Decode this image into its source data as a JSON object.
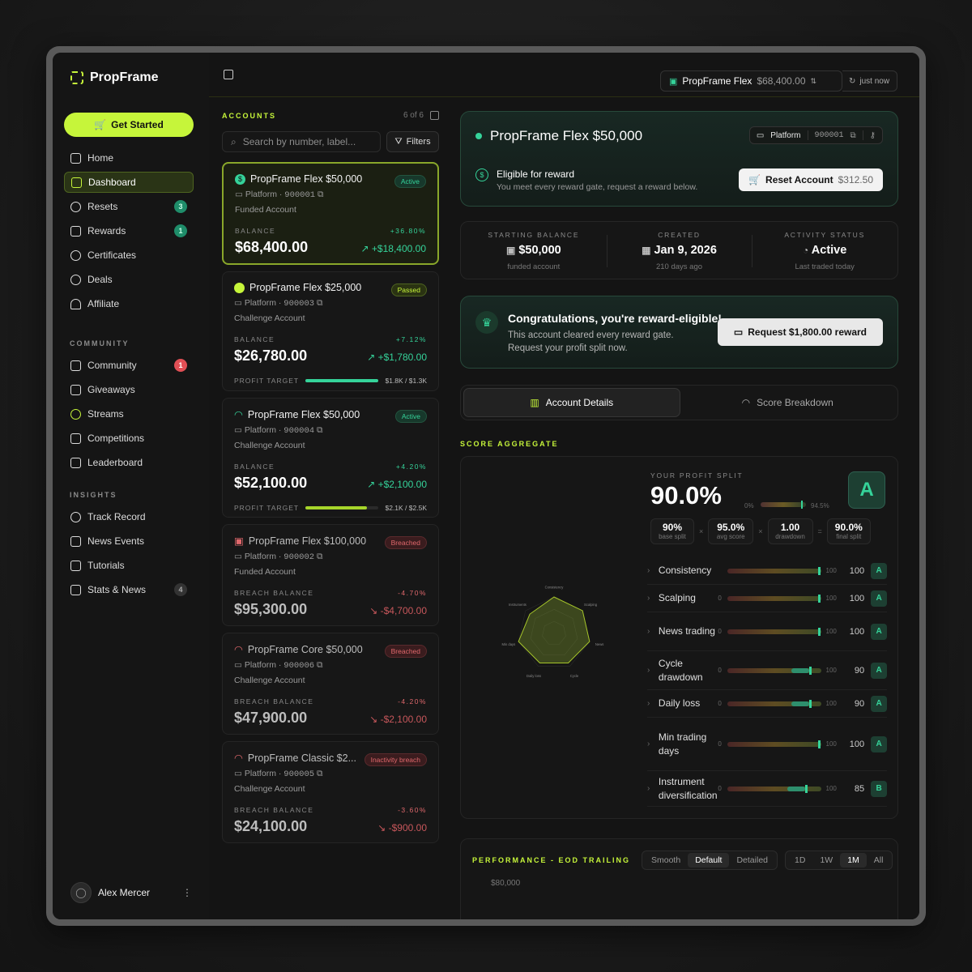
{
  "brand": {
    "name": "PropFrame",
    "accent": "#c6f53a",
    "positive": "#35d39a",
    "negative": "#e0686c"
  },
  "sidebar": {
    "cta": "Get Started",
    "main": [
      {
        "label": "Home",
        "icon": "home-icon"
      },
      {
        "label": "Dashboard",
        "icon": "grid-icon",
        "active": true
      },
      {
        "label": "Resets",
        "icon": "reset-icon",
        "badge": "3"
      },
      {
        "label": "Rewards",
        "icon": "ticket-icon",
        "badge": "1"
      },
      {
        "label": "Certificates",
        "icon": "certificate-icon"
      },
      {
        "label": "Deals",
        "icon": "tag-icon"
      },
      {
        "label": "Affiliate",
        "icon": "users-icon"
      }
    ],
    "community_title": "COMMUNITY",
    "community": [
      {
        "label": "Community",
        "badge": "1"
      },
      {
        "label": "Giveaways"
      },
      {
        "label": "Streams"
      },
      {
        "label": "Competitions"
      },
      {
        "label": "Leaderboard"
      }
    ],
    "insights_title": "INSIGHTS",
    "insights": [
      {
        "label": "Track Record"
      },
      {
        "label": "News Events"
      },
      {
        "label": "Tutorials"
      },
      {
        "label": "Stats & News",
        "badge": "4"
      }
    ],
    "user": "Alex Mercer"
  },
  "topbar": {
    "account": "PropFrame Flex",
    "balance": "$68,400.00",
    "updated": "just now"
  },
  "accounts": {
    "title": "ACCOUNTS",
    "count": "6 of 6",
    "search_placeholder": "Search by number, label...",
    "filters": "Filters",
    "items": [
      {
        "name": "PropFrame Flex $50,000",
        "status": "Active",
        "platform": "Platform",
        "number": "900001",
        "type": "Funded Account",
        "label": "BALANCE",
        "pct": "+36.80%",
        "balance": "$68,400.00",
        "delta": "+$18,400.00"
      },
      {
        "name": "PropFrame Flex $25,000",
        "status": "Passed",
        "platform": "Platform",
        "number": "900003",
        "type": "Challenge Account",
        "label": "BALANCE",
        "pct": "+7.12%",
        "balance": "$26,780.00",
        "delta": "+$1,780.00",
        "target_label": "PROFIT TARGET",
        "target": "$1.8K / $1.3K",
        "progress": 1.0
      },
      {
        "name": "PropFrame Flex $50,000",
        "status": "Active",
        "platform": "Platform",
        "number": "900004",
        "type": "Challenge Account",
        "label": "BALANCE",
        "pct": "+4.20%",
        "balance": "$52,100.00",
        "delta": "+$2,100.00",
        "target_label": "PROFIT TARGET",
        "target": "$2.1K / $2.5K",
        "progress": 0.84
      },
      {
        "name": "PropFrame Flex $100,000",
        "status": "Breached",
        "platform": "Platform",
        "number": "900002",
        "type": "Funded Account",
        "label": "BREACH BALANCE",
        "pct": "-4.70%",
        "balance": "$95,300.00",
        "delta": "-$4,700.00"
      },
      {
        "name": "PropFrame Core $50,000",
        "status": "Breached",
        "platform": "Platform",
        "number": "900006",
        "type": "Challenge Account",
        "label": "BREACH BALANCE",
        "pct": "-4.20%",
        "balance": "$47,900.00",
        "delta": "-$2,100.00"
      },
      {
        "name": "PropFrame Classic $2...",
        "status": "Inactivity breach",
        "platform": "Platform",
        "number": "900005",
        "type": "Challenge Account",
        "label": "BREACH BALANCE",
        "pct": "-3.60%",
        "balance": "$24,100.00",
        "delta": "-$900.00"
      }
    ]
  },
  "hero": {
    "title": "PropFrame Flex $50,000",
    "platform": "Platform",
    "number": "900001",
    "elig_title": "Eligible for reward",
    "elig_text": "You meet every reward gate, request a reward below.",
    "reset": "Reset Account",
    "reset_price": "$312.50"
  },
  "stats": [
    {
      "k": "STARTING BALANCE",
      "v": "$50,000",
      "s": "funded account"
    },
    {
      "k": "CREATED",
      "v": "Jan 9, 2026",
      "s": "210 days ago"
    },
    {
      "k": "ACTIVITY STATUS",
      "v": "Active",
      "s": "Last traded today"
    }
  ],
  "congrats": {
    "title": "Congratulations, you're reward-eligible!",
    "text": "This account cleared every reward gate. Request your profit split now.",
    "button": "Request $1,800.00 reward"
  },
  "tabs": [
    "Account Details",
    "Score Breakdown"
  ],
  "score": {
    "section": "SCORE AGGREGATE",
    "split_label": "YOUR PROFIT SPLIT",
    "split": "90.0%",
    "grade": "A",
    "range_min": "0%",
    "range_max": "94.5%",
    "factors": [
      {
        "v": "90%",
        "s": "base split"
      },
      {
        "v": "95.0%",
        "s": "avg score"
      },
      {
        "v": "1.00",
        "s": "drawdown"
      },
      {
        "v": "90.0%",
        "s": "final split"
      }
    ],
    "radar_labels": [
      "Consistency",
      "Scalping",
      "News",
      "Cycle",
      "Daily loss",
      "Min days",
      "Instruments"
    ],
    "rows": [
      {
        "name": "Consistency",
        "min": "",
        "max": "100",
        "score": "100",
        "grade": "A",
        "value": 100
      },
      {
        "name": "Scalping",
        "min": "0",
        "max": "100",
        "score": "100",
        "grade": "A",
        "value": 100
      },
      {
        "name": "News trading",
        "min": "0",
        "max": "100",
        "score": "100",
        "grade": "A",
        "value": 100
      },
      {
        "name": "Cycle drawdown",
        "min": "0",
        "max": "100",
        "score": "90",
        "grade": "A",
        "value": 90
      },
      {
        "name": "Daily loss",
        "min": "0",
        "max": "100",
        "score": "90",
        "grade": "A",
        "value": 90
      },
      {
        "name": "Min trading days",
        "min": "0",
        "max": "100",
        "score": "100",
        "grade": "A",
        "value": 100
      },
      {
        "name": "Instrument diversification",
        "min": "0",
        "max": "100",
        "score": "85",
        "grade": "B",
        "value": 85
      }
    ]
  },
  "performance": {
    "title": "PERFORMANCE - EOD TRAILING",
    "modes": [
      "Smooth",
      "Default",
      "Detailed"
    ],
    "ranges": [
      "1D",
      "1W",
      "1M",
      "All"
    ],
    "y_top": "$80,000"
  }
}
